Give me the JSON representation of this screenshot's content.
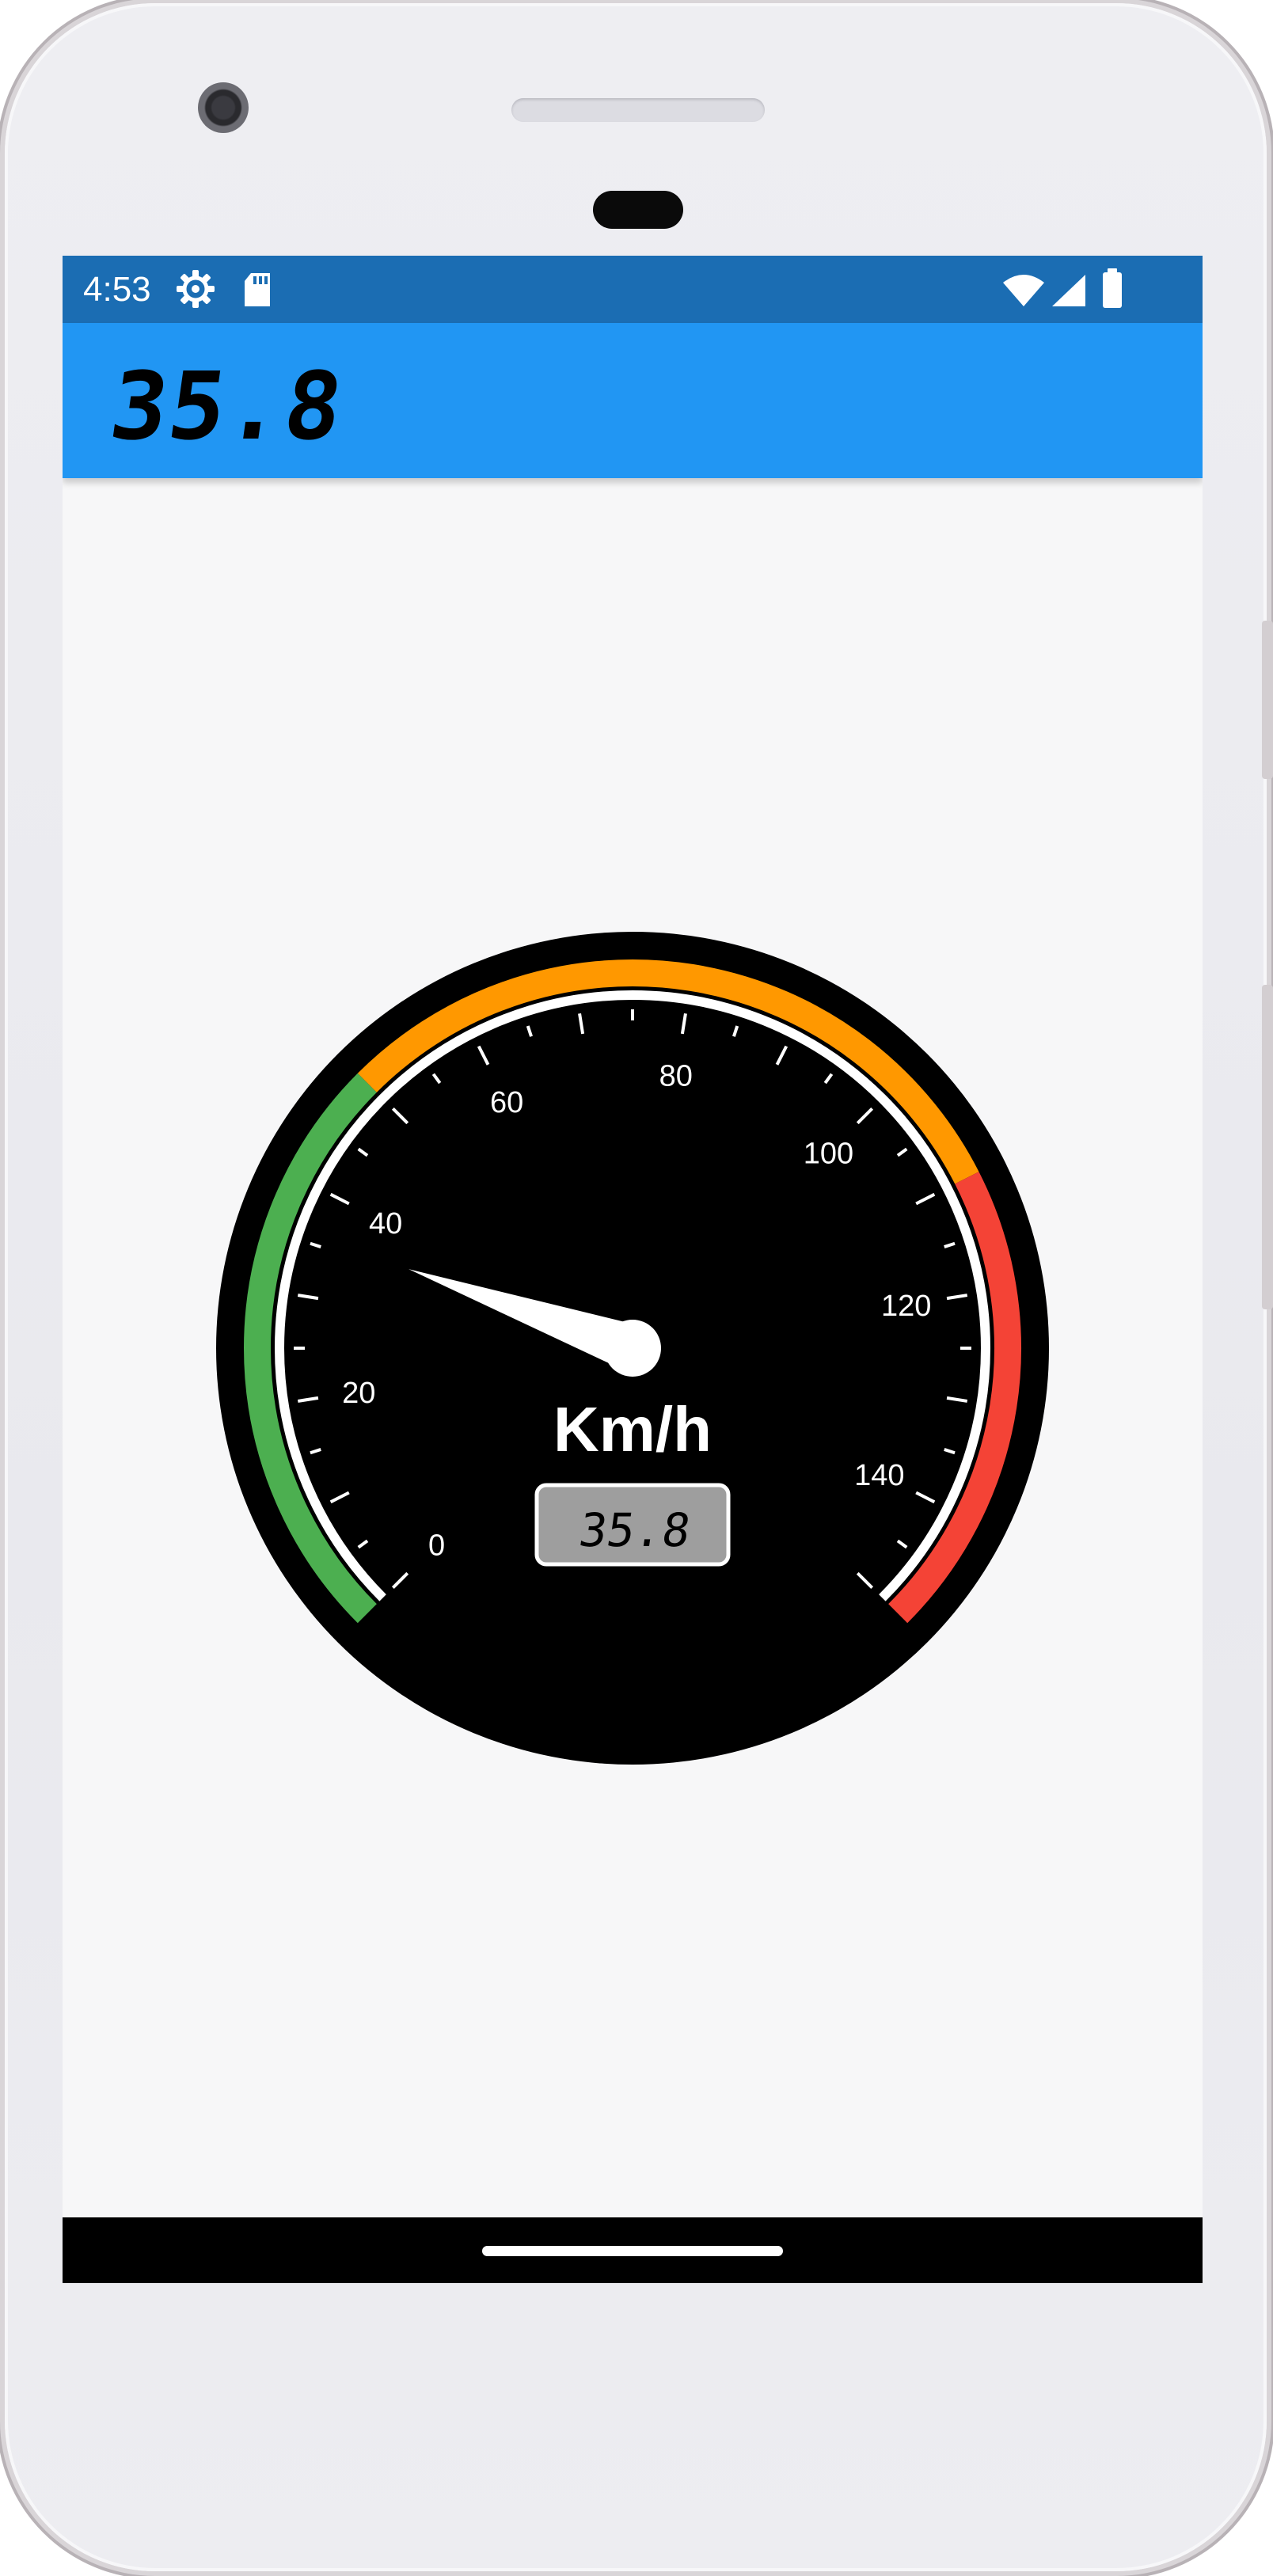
{
  "status_bar": {
    "time": "4:53",
    "icons": [
      "settings-gear-icon",
      "sd-card-icon",
      "wifi-icon",
      "cell-signal-icon",
      "battery-icon"
    ]
  },
  "app_bar": {
    "speed_readout": "35.8",
    "background_color": "#2196f3"
  },
  "gauge": {
    "unit_label": "Km/h",
    "value": 35.8,
    "value_display": "35.8",
    "min": 0,
    "max": 150,
    "tick_labels": [
      "0",
      "20",
      "40",
      "60",
      "80",
      "100",
      "120",
      "140"
    ],
    "ranges": [
      {
        "from": 0,
        "to": 50,
        "color": "#4caf50"
      },
      {
        "from": 50,
        "to": 110,
        "color": "#ff9800"
      },
      {
        "from": 110,
        "to": 150,
        "color": "#f44336"
      }
    ]
  }
}
